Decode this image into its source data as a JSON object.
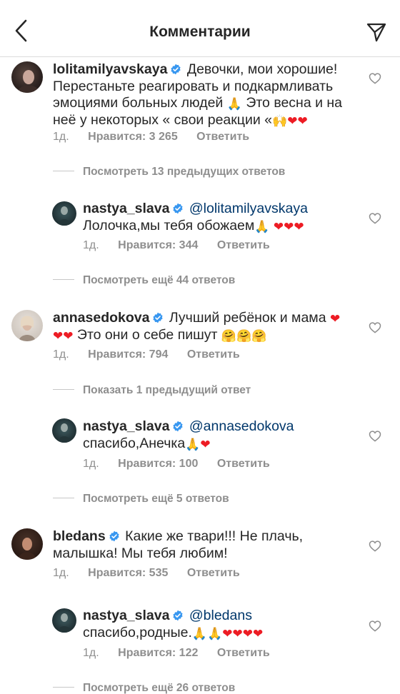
{
  "header": {
    "title": "Комментарии"
  },
  "comments": [
    {
      "username": "lolitamilyavskaya",
      "text1": "Девочки, мои хорошие! Перестаньте реагировать и подкармливать эмоциями больных людей",
      "text2": "Это весна и на неё у некоторых « свои реакции «",
      "time": "1д.",
      "likes": "Нравится: 3 265",
      "reply_label": "Ответить",
      "view_more": "Посмотреть 13 предыдущих ответов",
      "reply": {
        "username": "nastya_slava",
        "mention": "@lolitamilyavskaya",
        "text": "Лолочка,мы тебя обожаем",
        "time": "1д.",
        "likes": "Нравится: 344",
        "reply_label": "Ответить",
        "view_more": "Посмотреть ещё 44 ответов"
      }
    },
    {
      "username": "annasedokova",
      "text1": "Лучший ребёнок и мама",
      "text2": "Это они о себе пишут",
      "time": "1д.",
      "likes": "Нравится: 794",
      "reply_label": "Ответить",
      "view_more": "Показать 1 предыдущий ответ",
      "reply": {
        "username": "nastya_slava",
        "mention": "@annasedokova",
        "text": "спасибо,Анечка",
        "time": "1д.",
        "likes": "Нравится: 100",
        "reply_label": "Ответить",
        "view_more": "Посмотреть ещё 5 ответов"
      }
    },
    {
      "username": "bledans",
      "text1": "Какие же твари!!! Не плачь, малышка! Мы тебя любим!",
      "time": "1д.",
      "likes": "Нравится: 535",
      "reply_label": "Ответить",
      "reply": {
        "username": "nastya_slava",
        "mention": "@bledans",
        "text": "спасибо,родные.",
        "time": "1д.",
        "likes": "Нравится: 122",
        "reply_label": "Ответить",
        "view_more": "Посмотреть ещё 26 ответов"
      }
    }
  ],
  "icons": {
    "back": "chevron-left-icon",
    "send": "paper-plane-icon",
    "verified": "verified-badge-icon",
    "like": "heart-outline-icon"
  },
  "colors": {
    "verified": "#3897f0",
    "mention": "#00376b",
    "secondary_text": "#8e8e8e",
    "heart": "#ed1c24"
  }
}
